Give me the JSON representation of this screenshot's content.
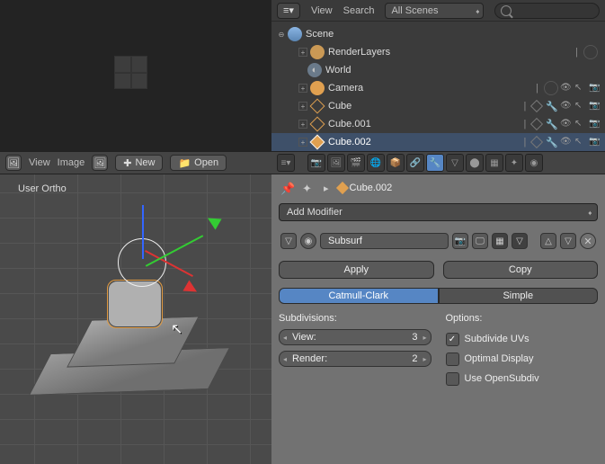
{
  "outliner": {
    "header": {
      "view": "View",
      "search_label": "Search",
      "filter": "All Scenes",
      "search_placeholder": ""
    },
    "scene": "Scene",
    "items": [
      {
        "name": "RenderLayers",
        "type": "render"
      },
      {
        "name": "World",
        "type": "world"
      },
      {
        "name": "Camera",
        "type": "camera"
      },
      {
        "name": "Cube",
        "type": "mesh"
      },
      {
        "name": "Cube.001",
        "type": "mesh"
      },
      {
        "name": "Cube.002",
        "type": "mesh",
        "selected": true
      }
    ]
  },
  "image_editor": {
    "header": {
      "view": "View",
      "image": "Image",
      "new": "New",
      "open": "Open"
    }
  },
  "viewport": {
    "label": "User Ortho"
  },
  "properties": {
    "breadcrumb": {
      "object": "Cube.002"
    },
    "add_modifier": "Add Modifier",
    "modifier": {
      "name": "Subsurf",
      "apply": "Apply",
      "copy": "Copy",
      "mode_a": "Catmull-Clark",
      "mode_b": "Simple",
      "subdivisions_label": "Subdivisions:",
      "view_label": "View:",
      "view_val": "3",
      "render_label": "Render:",
      "render_val": "2",
      "options_label": "Options:",
      "opt1": "Subdivide UVs",
      "opt2": "Optimal Display",
      "opt3": "Use OpenSubdiv"
    }
  }
}
